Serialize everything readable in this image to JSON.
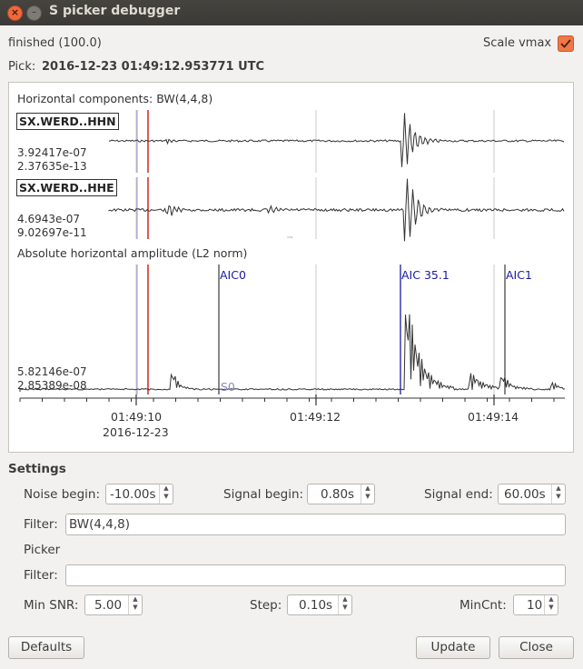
{
  "window": {
    "title": "S picker debugger",
    "close_glyph": "×",
    "minimize_glyph": "–"
  },
  "status": {
    "text": "finished (100.0)",
    "scale_vmax_label": "Scale vmax",
    "scale_vmax_checked": true
  },
  "pick": {
    "label": "Pick:",
    "value": "2016-12-23 01:49:12.953771 UTC"
  },
  "plot": {
    "horizontal_title": "Horizontal components: BW(4,4,8)",
    "channels": [
      {
        "name": "SX.WERD..HHN",
        "vmax": "3.92417e-07",
        "vmin": "2.37635e-13"
      },
      {
        "name": "SX.WERD..HHE",
        "vmax": "4.6943e-07",
        "vmin": "9.02697e-11"
      }
    ],
    "splitter_glyph": "'''",
    "amplitude_title": "Absolute horizontal amplitude (L2 norm)",
    "amplitude_vmax": "5.82146e-07",
    "amplitude_vmin": "2.85389e-08",
    "markers": {
      "aic0": "AIC0",
      "aic_main": "AIC 35.1",
      "aic1": "AIC1",
      "s0": "S0"
    },
    "time_ticks": [
      "01:49:10",
      "01:49:12",
      "01:49:14"
    ],
    "date_label": "2016-12-23",
    "colors": {
      "pick_line": "#cc0000",
      "ref_line": "#9a96e0",
      "aic_blue": "#1a1aa0",
      "grid": "#c8c8c8",
      "trace": "#333333"
    }
  },
  "settings": {
    "title": "Settings",
    "noise_begin_label": "Noise begin:",
    "noise_begin": "-10.00s",
    "signal_begin_label": "Signal begin:",
    "signal_begin": "0.80s",
    "signal_end_label": "Signal end:",
    "signal_end": "60.00s",
    "filter_label": "Filter:",
    "filter": "BW(4,4,8)",
    "picker_label": "Picker",
    "picker_filter_label": "Filter:",
    "picker_filter": "",
    "min_snr_label": "Min SNR:",
    "min_snr": "5.00",
    "step_label": "Step:",
    "step": "0.10s",
    "mincnt_label": "MinCnt:",
    "mincnt": "10",
    "spin_up": "▲",
    "spin_down": "▼"
  },
  "buttons": {
    "defaults": "Defaults",
    "update": "Update",
    "close": "Close"
  }
}
